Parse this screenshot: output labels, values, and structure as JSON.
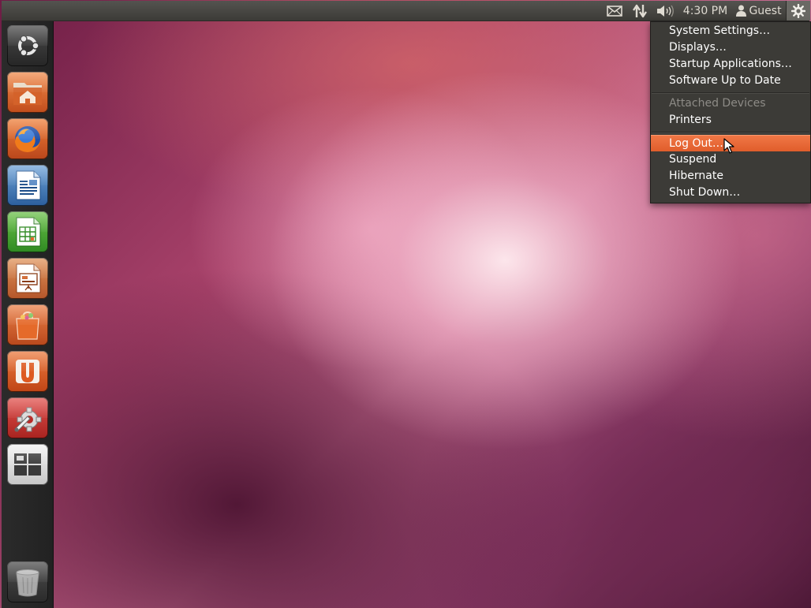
{
  "panel": {
    "clock": "4:30 PM",
    "user": "Guest",
    "indicators": [
      "mail-icon",
      "network-icon",
      "volume-icon",
      "user-icon",
      "gear-icon"
    ]
  },
  "launcher": {
    "items": [
      {
        "name": "dash-home",
        "icon": "ubuntu-logo-icon"
      },
      {
        "name": "home-folder",
        "icon": "home-folder-icon"
      },
      {
        "name": "firefox",
        "icon": "firefox-icon"
      },
      {
        "name": "writer",
        "icon": "writer-icon"
      },
      {
        "name": "calc",
        "icon": "calc-icon"
      },
      {
        "name": "impress",
        "icon": "impress-icon"
      },
      {
        "name": "software-center",
        "icon": "shopping-bag-icon"
      },
      {
        "name": "ubuntu-one",
        "icon": "ubuntu-one-icon"
      },
      {
        "name": "system-settings",
        "icon": "settings-wrench-icon"
      },
      {
        "name": "workspace-switcher",
        "icon": "workspaces-icon"
      },
      {
        "name": "trash",
        "icon": "trash-icon"
      }
    ]
  },
  "session_menu": {
    "items": [
      {
        "label": "System Settings…"
      },
      {
        "label": "Displays…"
      },
      {
        "label": "Startup Applications…"
      },
      {
        "label": "Software Up to Date"
      },
      {
        "label": "Attached Devices",
        "disabled": true
      },
      {
        "label": "Printers"
      },
      {
        "label": "Log Out…",
        "highlighted": true
      },
      {
        "label": "Suspend"
      },
      {
        "label": "Hibernate"
      },
      {
        "label": "Shut Down…"
      }
    ]
  },
  "colors": {
    "panel": "#3c3b37",
    "highlight": "#e96b38",
    "launcher": "#262626"
  }
}
